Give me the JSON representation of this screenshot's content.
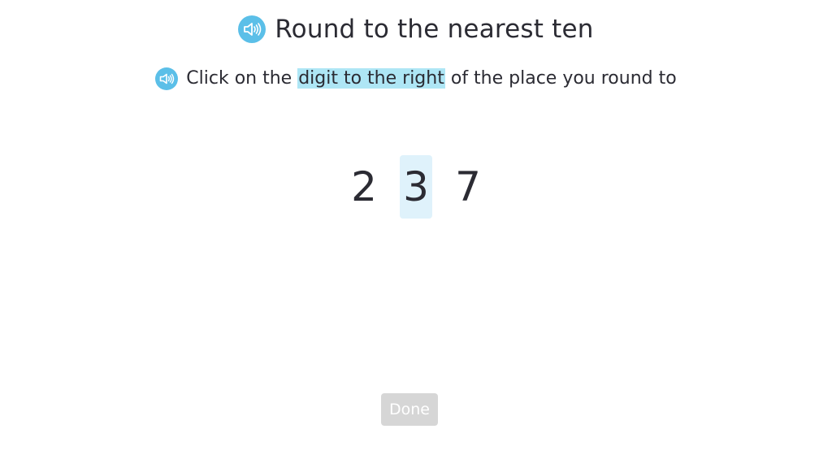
{
  "title": {
    "text": "Round to the nearest ten",
    "icon": "speaker-icon"
  },
  "instruction": {
    "before": "Click on the ",
    "highlight": "digit to the right",
    "after": " of the place you round to",
    "icon": "speaker-icon"
  },
  "number": {
    "digits": [
      "2",
      "3",
      "7"
    ],
    "selected_index": 1
  },
  "done_button": {
    "label": "Done",
    "enabled": false
  },
  "colors": {
    "speaker": "#5bbfe8",
    "highlight": "#aee6f5",
    "selected_digit_bg": "#dff2fb",
    "button_disabled": "#d6d6d6"
  }
}
